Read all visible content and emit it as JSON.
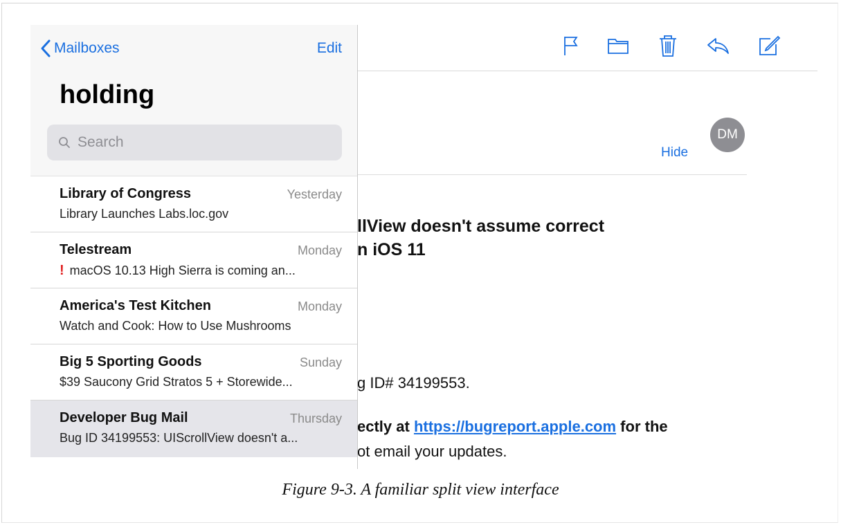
{
  "caption": "Figure 9-3. A familiar split view interface",
  "master": {
    "back_label": "Mailboxes",
    "edit_label": "Edit",
    "title": "holding",
    "search_placeholder": "Search",
    "messages": [
      {
        "sender": "Library of Congress",
        "date": "Yesterday",
        "preview": "Library Launches Labs.loc.gov",
        "flag": ""
      },
      {
        "sender": "Telestream",
        "date": "Monday",
        "preview": "macOS 10.13 High Sierra is coming an...",
        "flag": "!"
      },
      {
        "sender": "America's Test Kitchen",
        "date": "Monday",
        "preview": "Watch and Cook: How to Use Mushrooms",
        "flag": ""
      },
      {
        "sender": "Big 5 Sporting Goods",
        "date": "Sunday",
        "preview": "$39 Saucony Grid Stratos 5 + Storewide...",
        "flag": ""
      },
      {
        "sender": "Developer Bug Mail",
        "date": "Thursday",
        "preview": "Bug ID 34199553: UIScrollView doesn't a...",
        "flag": ""
      }
    ]
  },
  "detail": {
    "toolbar_icons": [
      "flag-icon",
      "folder-icon",
      "trash-icon",
      "reply-icon",
      "compose-icon"
    ],
    "avatar_initials": "DM",
    "hide_label": "Hide",
    "subject_line1": "llView doesn't assume correct",
    "subject_line2": "n iOS 11",
    "body_line1": "g ID# 34199553.",
    "body_line2_prefix": "ectly at ",
    "body_link": "https://bugreport.apple.com",
    "body_line2_suffix": " for the",
    "body_line3": "ot email your updates."
  },
  "colors": {
    "accent": "#1a6fe0",
    "flag_red": "#e02020",
    "selected_row": "#e5e5ea",
    "avatar": "#8e8e93"
  }
}
